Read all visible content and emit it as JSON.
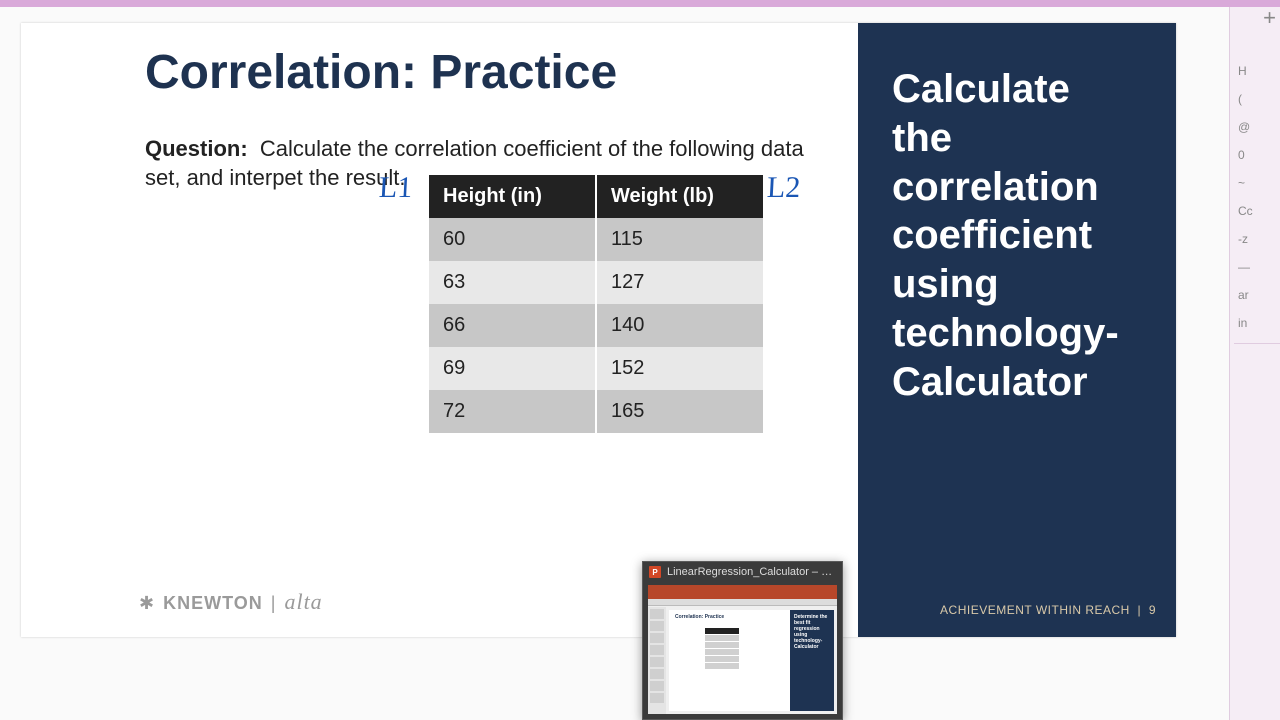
{
  "slide": {
    "title": "Correlation: Practice",
    "question_label": "Question:",
    "question_text": "Calculate the correlation coefficient of the following data set, and interpet the result.",
    "annotation_left": "L1",
    "annotation_right": "L2",
    "brand_main": "KNEWTON",
    "brand_sep": "|",
    "brand_sub": "alta"
  },
  "table": {
    "headers": [
      "Height (in)",
      "Weight (lb)"
    ],
    "rows": [
      [
        "60",
        "115"
      ],
      [
        "63",
        "127"
      ],
      [
        "66",
        "140"
      ],
      [
        "69",
        "152"
      ],
      [
        "72",
        "165"
      ]
    ]
  },
  "panel": {
    "lines": [
      "Calculate",
      "the",
      "correlation",
      "coefficient",
      "using",
      "technology-",
      "Calculator"
    ],
    "footer_text": "ACHIEVEMENT WITHIN REACH",
    "footer_sep": "|",
    "page_num": "9"
  },
  "thumb": {
    "icon_text": "P",
    "title": "LinearRegression_Calculator  –  …",
    "mini_title": "Correlation: Practice",
    "mini_panel": "Determine the best fit regression using technology- Calculator"
  },
  "strip": {
    "plus": "+",
    "items": [
      "H",
      "(",
      "@",
      "0",
      "~",
      "Cc",
      "-z",
      "—",
      "ar",
      "in"
    ]
  },
  "chart_data": {
    "type": "table",
    "title": "Correlation: Practice",
    "columns": [
      "Height (in)",
      "Weight (lb)"
    ],
    "rows": [
      [
        60,
        115
      ],
      [
        63,
        127
      ],
      [
        66,
        140
      ],
      [
        69,
        152
      ],
      [
        72,
        165
      ]
    ]
  }
}
